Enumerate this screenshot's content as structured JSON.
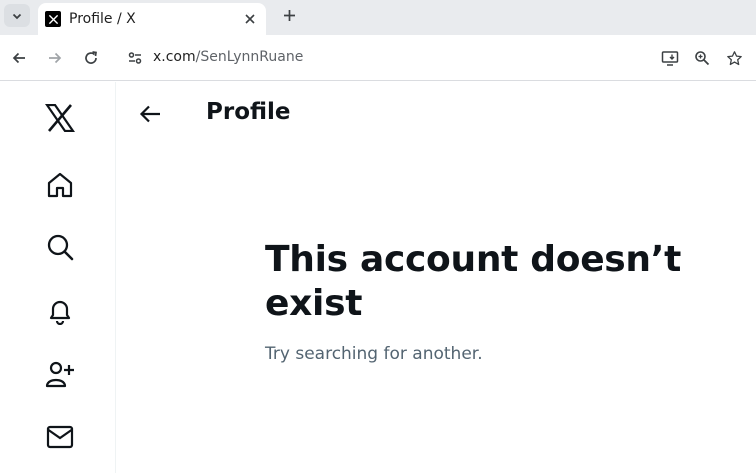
{
  "browser": {
    "tab": {
      "title": "Profile / X",
      "favicon": "x-logo-icon"
    },
    "url": {
      "host": "x.com",
      "path": "/SenLynnRuane"
    },
    "toolbar_icons": [
      "back-icon",
      "forward-icon",
      "reload-icon",
      "site-info-icon",
      "install-app-icon",
      "zoom-icon",
      "bookmark-star-icon"
    ]
  },
  "sidebar": {
    "items": [
      {
        "icon": "x-logo-icon"
      },
      {
        "icon": "home-icon"
      },
      {
        "icon": "search-icon"
      },
      {
        "icon": "notifications-bell-icon"
      },
      {
        "icon": "follow-person-add-icon"
      },
      {
        "icon": "messages-envelope-icon"
      }
    ]
  },
  "header": {
    "title": "Profile"
  },
  "empty_state": {
    "title": "This account doesn’t exist",
    "subtitle": "Try searching for another."
  },
  "colors": {
    "text_primary": "#0f1419",
    "text_secondary": "#536471",
    "tabstrip_bg": "#e9ebee",
    "divider": "#eff3f4"
  }
}
